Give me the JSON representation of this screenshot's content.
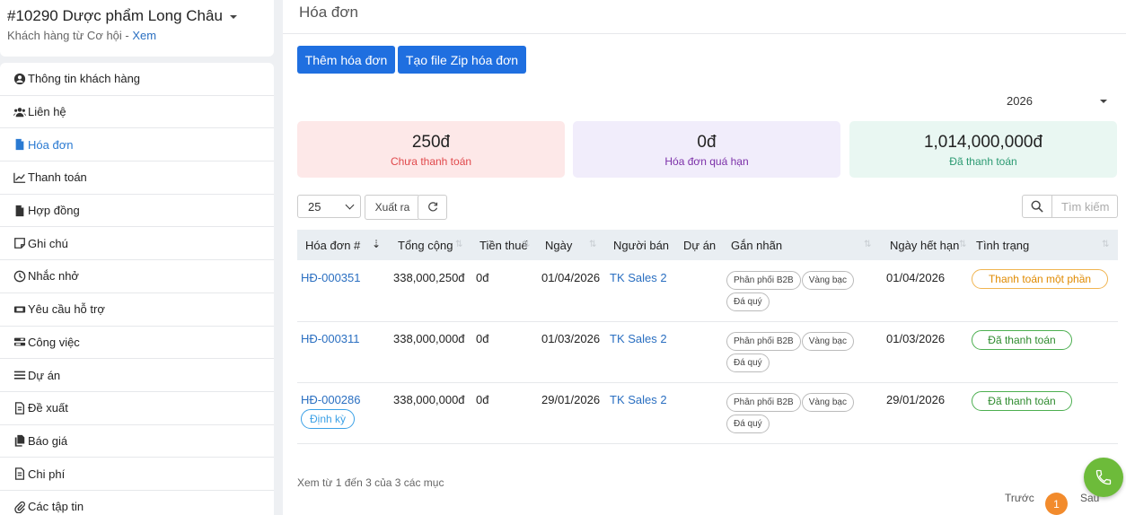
{
  "customer": {
    "title": "#10290 Dược phẩm Long Châu",
    "subtitle_prefix": "Khách hàng từ Cơ hội - ",
    "subtitle_link": "Xem"
  },
  "sidebar": {
    "items": [
      {
        "label": "Thông tin khách hàng",
        "icon": "user-circle-icon",
        "active": false
      },
      {
        "label": "Liên hệ",
        "icon": "users-icon",
        "active": false
      },
      {
        "label": "Hóa đơn",
        "icon": "file-icon",
        "active": true
      },
      {
        "label": "Thanh toán",
        "icon": "line-chart-icon",
        "active": false
      },
      {
        "label": "Hợp đồng",
        "icon": "file-icon",
        "active": false
      },
      {
        "label": "Ghi chú",
        "icon": "note-icon",
        "active": false
      },
      {
        "label": "Nhắc nhở",
        "icon": "clock-icon",
        "active": false
      },
      {
        "label": "Yêu cầu hỗ trợ",
        "icon": "ticket-icon",
        "active": false
      },
      {
        "label": "Công việc",
        "icon": "tasks-icon",
        "active": false
      },
      {
        "label": "Dự án",
        "icon": "bars-icon",
        "active": false
      },
      {
        "label": "Đề xuất",
        "icon": "file-text-icon",
        "active": false
      },
      {
        "label": "Báo giá",
        "icon": "copy-icon",
        "active": false
      },
      {
        "label": "Chi phí",
        "icon": "file-text-icon",
        "active": false
      },
      {
        "label": "Các tập tin",
        "icon": "paperclip-icon",
        "active": false
      }
    ]
  },
  "main": {
    "title": "Hóa đơn",
    "add_invoice": "Thêm hóa đơn",
    "zip_invoice": "Tạo file Zip hóa đơn",
    "year": "2026",
    "stats": [
      {
        "amount": "250đ",
        "label": "Chưa thanh toán",
        "bg": "#fde8e8",
        "color": "#e0484b"
      },
      {
        "amount": "0đ",
        "label": "Hóa đơn quá hạn",
        "bg": "#f1edfb",
        "color": "#7b2fa8"
      },
      {
        "amount": "1,014,000,000đ",
        "label": "Đã thanh toán",
        "bg": "#e9f7f2",
        "color": "#2b9a72"
      }
    ],
    "page_length": "25",
    "export_label": "Xuất ra",
    "search_placeholder": "Tìm kiếm",
    "columns": [
      "Hóa đơn #",
      "Tổng cộng",
      "Tiền thuế",
      "Ngày",
      "Người bán",
      "Dự án",
      "Gắn nhãn",
      "Ngày hết hạn",
      "Tình trạng"
    ],
    "rows": [
      {
        "id": "HĐ-000351",
        "total": "338,000,250đ",
        "tax": "0đ",
        "date": "01/04/2026",
        "seller": "TK Sales 2",
        "project": "",
        "tags": [
          "Phân phối B2B",
          "Vàng bạc",
          "Đá quý"
        ],
        "due": "01/04/2026",
        "status": "Thanh toán một phần",
        "status_type": "partial",
        "recurring": ""
      },
      {
        "id": "HĐ-000311",
        "total": "338,000,000đ",
        "tax": "0đ",
        "date": "01/03/2026",
        "seller": "TK Sales 2",
        "project": "",
        "tags": [
          "Phân phối B2B",
          "Vàng bạc",
          "Đá quý"
        ],
        "due": "01/03/2026",
        "status": "Đã thanh toán",
        "status_type": "paid",
        "recurring": ""
      },
      {
        "id": "HĐ-000286",
        "total": "338,000,000đ",
        "tax": "0đ",
        "date": "29/01/2026",
        "seller": "TK Sales 2",
        "project": "",
        "tags": [
          "Phân phối B2B",
          "Vàng bạc",
          "Đá quý"
        ],
        "due": "29/01/2026",
        "status": "Đã thanh toán",
        "status_type": "paid",
        "recurring": "Định kỳ"
      }
    ],
    "info": "Xem từ 1 đến 3 của 3 các mục",
    "prev": "Trước",
    "page": "1",
    "next": "Sau"
  }
}
